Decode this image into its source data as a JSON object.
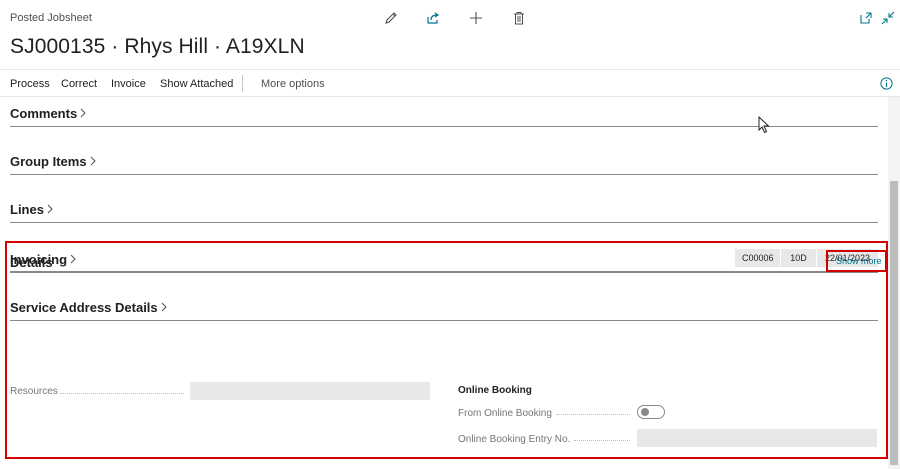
{
  "header": {
    "page_type": "Posted Jobsheet",
    "title": "SJ000135 · Rhys Hill · A19XLN",
    "icons": [
      "edit-icon",
      "share-icon",
      "new-icon",
      "delete-icon",
      "open-in-new-window-icon",
      "collapse-icon"
    ]
  },
  "actions": {
    "items": [
      "Process",
      "Correct",
      "Invoice",
      "Show Attached"
    ],
    "more": "More options"
  },
  "groups": {
    "comments": "Comments",
    "group_items": "Group Items",
    "lines": "Lines",
    "invoicing": "Invoicing",
    "service_address": "Service Address Details"
  },
  "invoicing_summary": [
    "C00006",
    "10D",
    "22/01/2023"
  ],
  "details": {
    "title": "Details",
    "show_more": "Show more",
    "resources_label": "Resources",
    "resources_value": "",
    "online_booking_title": "Online Booking",
    "from_online_booking_label": "From Online Booking",
    "from_online_booking_value": false,
    "entry_no_label": "Online Booking Entry No.",
    "entry_no_value": ""
  },
  "colors": {
    "accent": "#00758f",
    "highlight_border": "#d40000",
    "field_background": "#e8e8e8"
  }
}
